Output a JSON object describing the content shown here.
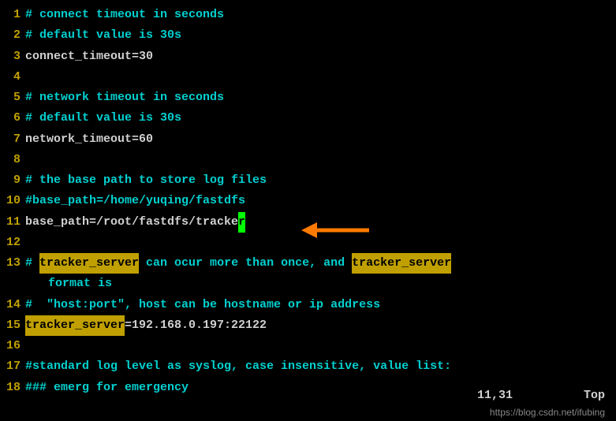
{
  "lines": {
    "l1": {
      "num": "1",
      "comment": "# connect timeout in seconds"
    },
    "l2": {
      "num": "2",
      "comment": "# default value is 30s"
    },
    "l3": {
      "num": "3",
      "plain": "connect_timeout=30"
    },
    "l4": {
      "num": "4"
    },
    "l5": {
      "num": "5",
      "comment": "# network timeout in seconds"
    },
    "l6": {
      "num": "6",
      "comment": "# default value is 30s"
    },
    "l7": {
      "num": "7",
      "plain": "network_timeout=60"
    },
    "l8": {
      "num": "8"
    },
    "l9": {
      "num": "9",
      "comment": "# the base path to store log files"
    },
    "l10": {
      "num": "10",
      "comment": "#base_path=/home/yuqing/fastdfs"
    },
    "l11": {
      "num": "11",
      "pre": "base_path=/root/fastdfs/tracke",
      "cursor": "r"
    },
    "l12": {
      "num": "12"
    },
    "l13": {
      "num": "13",
      "p1": "# ",
      "h1": "tracker_server",
      "p2": " can ocur more than once, and ",
      "h2": "tracker_server",
      "cont": " format is"
    },
    "l14": {
      "num": "14",
      "comment": "#  \"host:port\", host can be hostname or ip address"
    },
    "l15": {
      "num": "15",
      "h1": "tracker_server",
      "p1": "=192.168.0.197:22122"
    },
    "l16": {
      "num": "16"
    },
    "l17": {
      "num": "17",
      "comment": "#standard log level as syslog, case insensitive, value list:"
    },
    "l18": {
      "num": "18",
      "comment": "### emerg for emergency"
    }
  },
  "status": {
    "pos": "11,31",
    "scroll": "Top"
  },
  "watermark": "https://blog.csdn.net/ifubing"
}
